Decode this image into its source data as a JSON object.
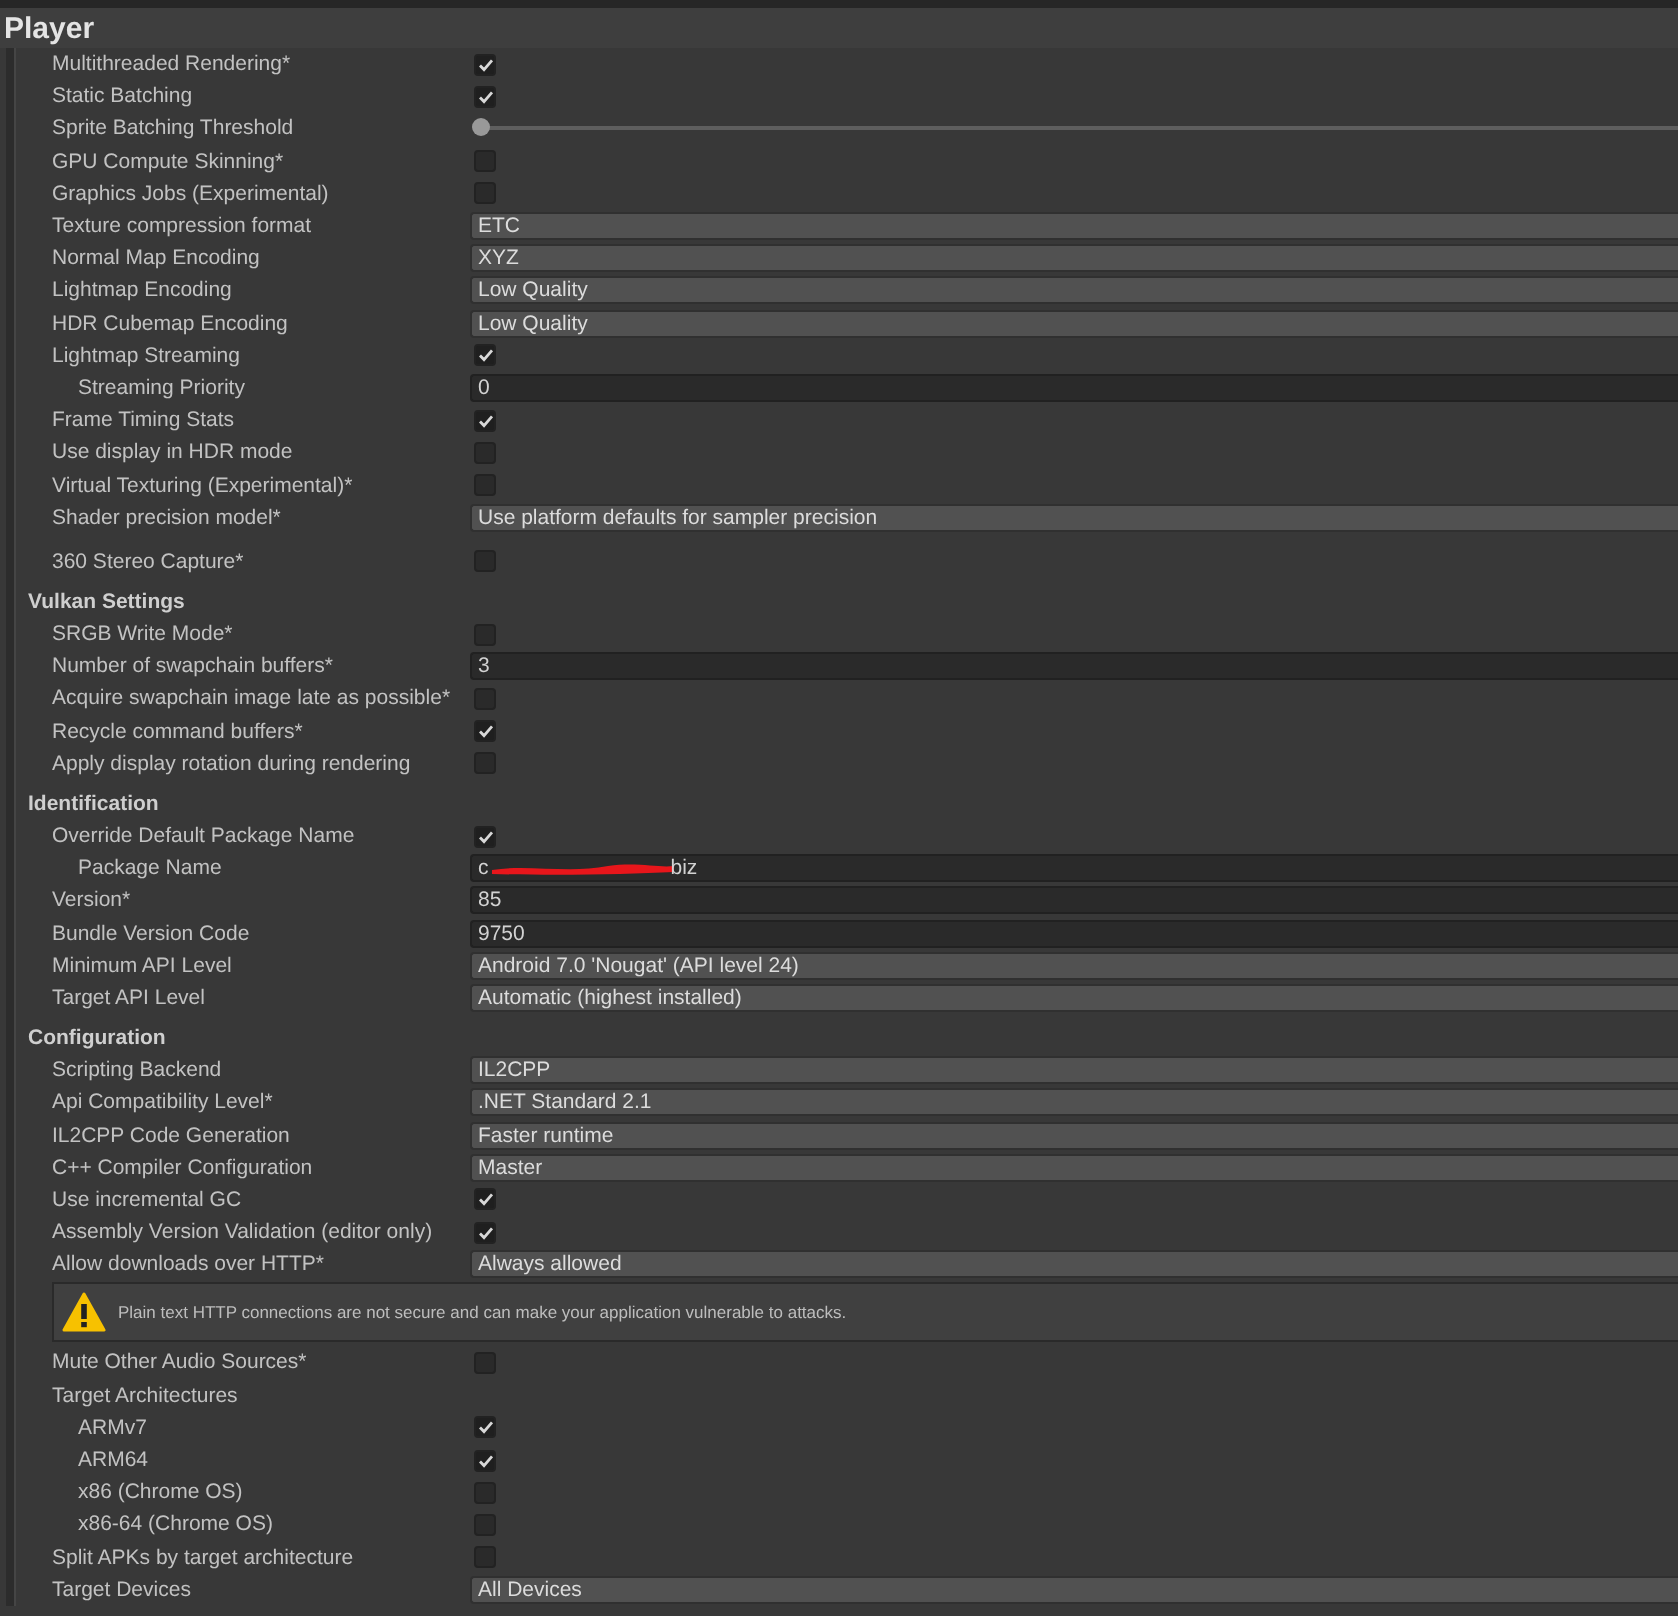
{
  "title": "Player",
  "sections": [
    {
      "items": [
        {
          "kind": "checkbox",
          "label": "Multithreaded Rendering*",
          "checked": true
        },
        {
          "kind": "checkbox",
          "label": "Static Batching",
          "checked": true
        },
        {
          "kind": "slider",
          "label": "Sprite Batching Threshold",
          "level": 0
        },
        {
          "kind": "checkbox",
          "label": "GPU Compute Skinning*",
          "checked": false
        },
        {
          "kind": "checkbox",
          "label": "Graphics Jobs (Experimental)",
          "checked": false
        },
        {
          "kind": "dropdown",
          "label": "Texture compression format",
          "value": "ETC"
        },
        {
          "kind": "dropdown",
          "label": "Normal Map Encoding",
          "value": "XYZ"
        },
        {
          "kind": "dropdown",
          "label": "Lightmap Encoding",
          "value": "Low Quality"
        },
        {
          "kind": "dropdown",
          "label": "HDR Cubemap Encoding",
          "value": "Low Quality"
        },
        {
          "kind": "checkbox",
          "label": "Lightmap Streaming",
          "checked": true,
          "children": [
            {
              "kind": "textfield",
              "label": "Streaming Priority",
              "value": "0"
            }
          ]
        },
        {
          "kind": "checkbox",
          "label": "Frame Timing Stats",
          "checked": true
        },
        {
          "kind": "checkbox",
          "label": "Use display in HDR mode",
          "checked": false
        },
        {
          "kind": "checkbox",
          "label": "Virtual Texturing (Experimental)*",
          "checked": false
        },
        {
          "kind": "dropdown",
          "label": "Shader precision model*",
          "value": "Use platform defaults for sampler precision"
        },
        {
          "kind": "checkbox",
          "label": "360 Stereo Capture*",
          "checked": false,
          "gap_before": true
        }
      ]
    },
    {
      "heading": "Vulkan Settings",
      "items": [
        {
          "kind": "checkbox",
          "label": "SRGB Write Mode*",
          "checked": false
        },
        {
          "kind": "textfield",
          "label": "Number of swapchain buffers*",
          "value": "3"
        },
        {
          "kind": "checkbox",
          "label": "Acquire swapchain image late as possible*",
          "checked": false
        },
        {
          "kind": "checkbox",
          "label": "Recycle command buffers*",
          "checked": true
        },
        {
          "kind": "checkbox",
          "label": "Apply display rotation during rendering",
          "checked": false
        }
      ]
    },
    {
      "heading": "Identification",
      "items": [
        {
          "kind": "checkbox",
          "label": "Override Default Package Name",
          "checked": true,
          "children": [
            {
              "kind": "textfield",
              "label": "Package Name",
              "value": "c",
              "value_end": "biz",
              "redacted": true
            }
          ]
        },
        {
          "kind": "textfield",
          "label": "Version*",
          "value": "85"
        },
        {
          "kind": "textfield",
          "label": "Bundle Version Code",
          "value": "9750"
        },
        {
          "kind": "dropdown",
          "label": "Minimum API Level",
          "value": "Android 7.0 'Nougat' (API level 24)"
        },
        {
          "kind": "dropdown",
          "label": "Target API Level",
          "value": "Automatic (highest installed)"
        }
      ]
    },
    {
      "heading": "Configuration",
      "items": [
        {
          "kind": "dropdown",
          "label": "Scripting Backend",
          "value": "IL2CPP"
        },
        {
          "kind": "dropdown",
          "label": "Api Compatibility Level*",
          "value": ".NET Standard 2.1"
        },
        {
          "kind": "dropdown",
          "label": "IL2CPP Code Generation",
          "value": "Faster runtime"
        },
        {
          "kind": "dropdown",
          "label": "C++ Compiler Configuration",
          "value": "Master"
        },
        {
          "kind": "checkbox",
          "label": "Use incremental GC",
          "checked": true
        },
        {
          "kind": "checkbox",
          "label": "Assembly Version Validation (editor only)",
          "checked": true
        },
        {
          "kind": "dropdown",
          "label": "Allow downloads over HTTP*",
          "value": "Always allowed"
        },
        {
          "kind": "warning",
          "text": "Plain text HTTP connections are not secure and can make your application vulnerable to attacks."
        },
        {
          "kind": "checkbox",
          "label": "Mute Other Audio Sources*",
          "checked": false
        },
        {
          "kind": "label",
          "label": "Target Architectures",
          "children": [
            {
              "kind": "checkbox",
              "label": "ARMv7",
              "checked": true
            },
            {
              "kind": "checkbox",
              "label": "ARM64",
              "checked": true
            },
            {
              "kind": "checkbox",
              "label": "x86 (Chrome OS)",
              "checked": false
            },
            {
              "kind": "checkbox",
              "label": "x86-64 (Chrome OS)",
              "checked": false
            }
          ]
        },
        {
          "kind": "checkbox",
          "label": "Split APKs by target architecture",
          "checked": false
        },
        {
          "kind": "dropdown",
          "label": "Target Devices",
          "value": "All Devices"
        }
      ]
    }
  ]
}
